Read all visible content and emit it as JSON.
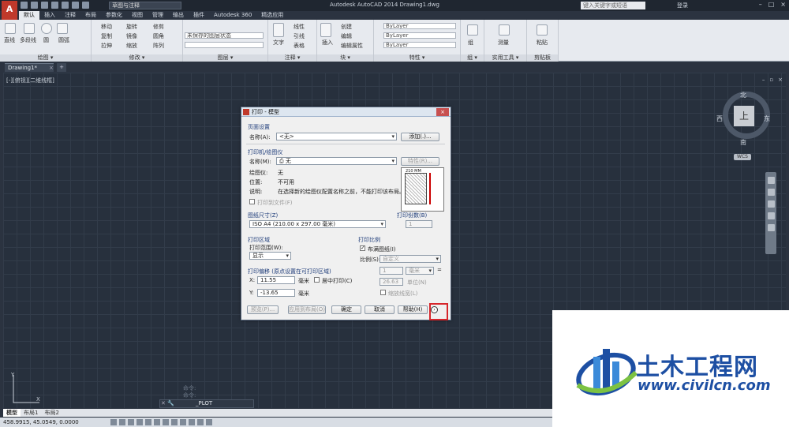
{
  "app": {
    "logo": "A",
    "workspace": "草图与注释",
    "title": "Autodesk AutoCAD 2014    Drawing1.dwg",
    "help_search_placeholder": "键入关键字或短语",
    "login": "登录"
  },
  "ribbon": {
    "tabs": [
      "默认",
      "插入",
      "注释",
      "布局",
      "参数化",
      "视图",
      "管理",
      "输出",
      "插件",
      "Autodesk 360",
      "精选应用"
    ],
    "active_tab": "默认",
    "draw": {
      "title": "绘图 ▾",
      "items": [
        "直线",
        "多段线",
        "圆",
        "圆弧"
      ]
    },
    "modify": {
      "title": "修改 ▾",
      "items": [
        "移动",
        "旋转",
        "修剪",
        "复制",
        "镜像",
        "圆角",
        "拉伸",
        "缩放",
        "阵列"
      ]
    },
    "layers": {
      "title": "图层 ▾",
      "state": "未保存的图层状态"
    },
    "annotation": {
      "title": "注释 ▾",
      "items": [
        "文字",
        "标注",
        "线性",
        "引线",
        "表格"
      ]
    },
    "block": {
      "title": "块 ▾",
      "items": [
        "插入",
        "创建",
        "编辑",
        "编辑属性"
      ]
    },
    "properties": {
      "title": "特性 ▾",
      "rows": [
        "ByLayer",
        "ByLayer",
        "ByLayer"
      ]
    },
    "groups": {
      "title": "组 ▾",
      "items": [
        "组"
      ]
    },
    "utilities": {
      "title": "实用工具 ▾",
      "items": [
        "测量"
      ]
    },
    "clipboard": {
      "title": "剪贴板",
      "items": [
        "粘贴"
      ]
    }
  },
  "file_tab": {
    "label": "Drawing1*",
    "close": "×",
    "new": "+"
  },
  "viewport": {
    "label": "[-][俯视][二维线框]"
  },
  "viewcube": {
    "top": "上",
    "north": "北",
    "south": "南",
    "east": "东",
    "west": "西",
    "wcs": "WCS"
  },
  "command": {
    "history1": "命令:",
    "history2": "命令:",
    "current": "_PLOT"
  },
  "layout_tabs": [
    "模型",
    "布局1",
    "布局2"
  ],
  "status": {
    "coords": "458.9915, 45.0549, 0.0000"
  },
  "dialog": {
    "title": "打印 - 模型",
    "close": "×",
    "page_setup": {
      "group": "页面设置",
      "name_label": "名称(A):",
      "name_value": "<无>",
      "add_button": "添加(.)..."
    },
    "printer": {
      "group": "打印机/绘图仪",
      "name_label": "名称(M):",
      "name_value": "无",
      "props_button": "特性(R)...",
      "plotter_label": "绘图仪:",
      "plotter_value": "无",
      "where_label": "位置:",
      "where_value": "不可用",
      "desc_label": "说明:",
      "desc_value": "在选择新的绘图仪配置名称之前，不能打印该布局。",
      "print_to_file": "打印到文件(F)",
      "preview_dim": "210 MM"
    },
    "paper": {
      "group": "图纸尺寸(Z)",
      "value": "ISO A4 (210.00 x 297.00 毫米)"
    },
    "copies": {
      "group": "打印份数(B)",
      "value": "1"
    },
    "area": {
      "group": "打印区域",
      "what_label": "打印范围(W):",
      "what_value": "显示"
    },
    "scale": {
      "group": "打印比例",
      "fit_label": "布满图纸(I)",
      "fit_checked": true,
      "scale_label": "比例(S):",
      "scale_value": "自定义",
      "value1": "1",
      "unit1": "毫米",
      "value2": "26.63",
      "unit2": "单位(N)",
      "lineweights": "缩放线宽(L)",
      "eq": "="
    },
    "offset": {
      "group": "打印偏移 (原点设置在可打印区域)",
      "x_label": "X:",
      "x_value": "11.55",
      "x_unit": "毫米",
      "y_label": "Y:",
      "y_value": "-13.65",
      "y_unit": "毫米",
      "center": "居中打印(C)"
    },
    "buttons": {
      "preview": "预览(P)...",
      "apply": "应用到布局(O)",
      "ok": "确定",
      "cancel": "取消",
      "help": "帮助(H)",
      "expand": "›"
    }
  },
  "watermark": {
    "brand": "土木工程网",
    "url": "www.civilcn.com"
  }
}
